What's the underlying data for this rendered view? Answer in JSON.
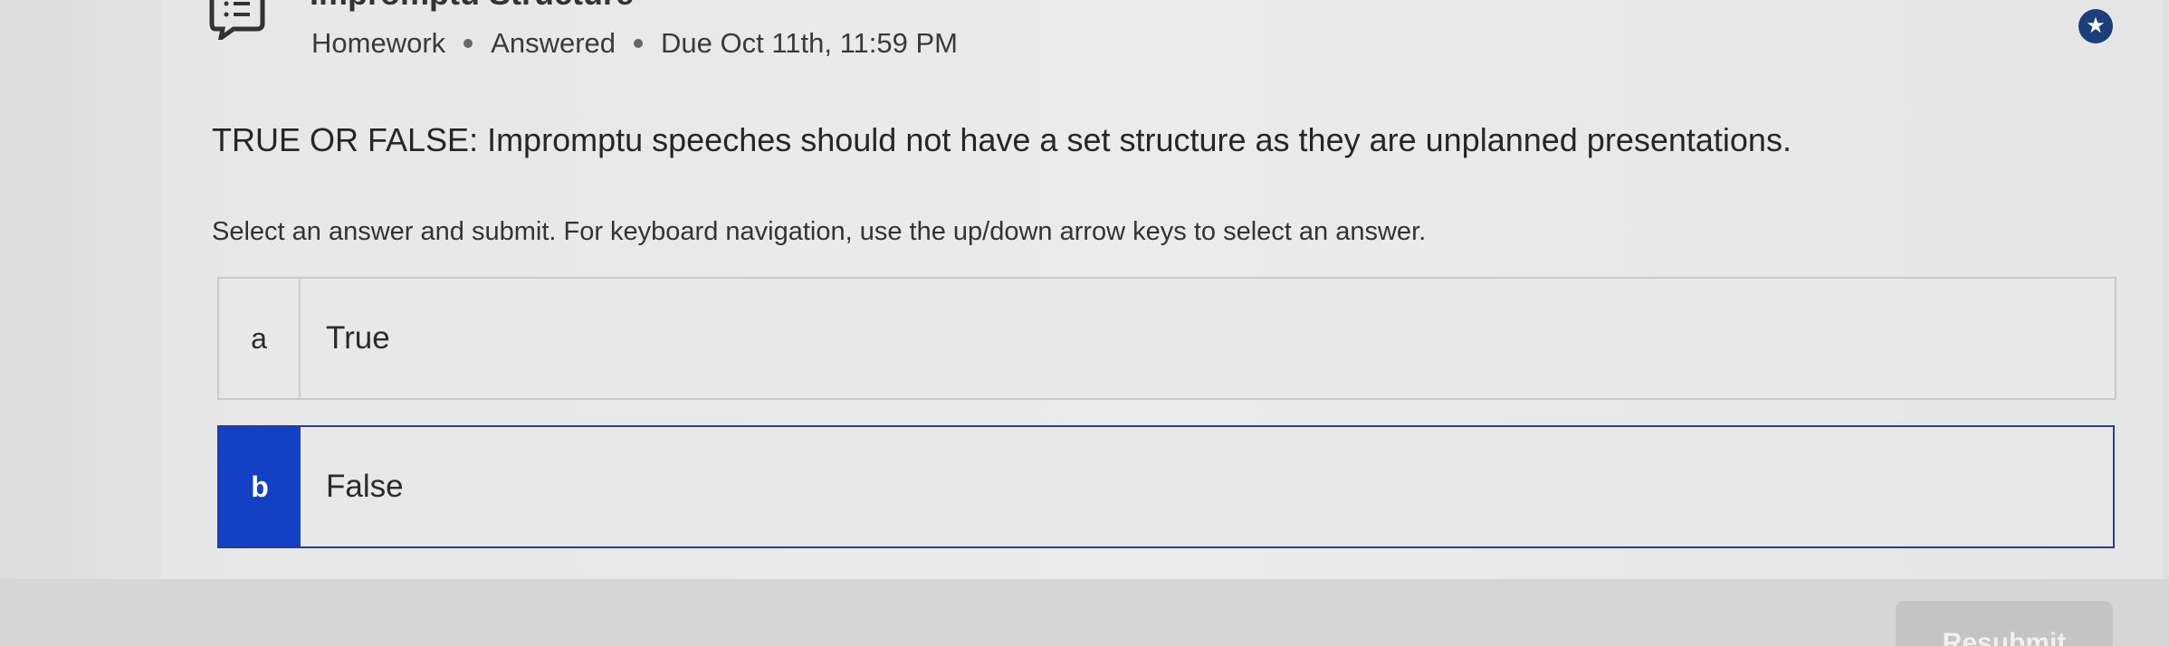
{
  "header": {
    "title": "Impromptu Structure",
    "type": "Homework",
    "status": "Answered",
    "due": "Due Oct 11th, 11:59 PM"
  },
  "question": {
    "text": "TRUE OR FALSE: Impromptu speeches should not have a set structure as they are unplanned presentations.",
    "instructions": "Select an answer and submit. For keyboard navigation, use the up/down arrow keys to select an answer."
  },
  "options": [
    {
      "letter": "a",
      "text": "True",
      "selected": false
    },
    {
      "letter": "b",
      "text": "False",
      "selected": true
    }
  ],
  "actions": {
    "resubmit_label": "Resubmit"
  },
  "icons": {
    "topic": "list-chat-icon",
    "favorite": "star-icon"
  },
  "colors": {
    "accent": "#1441c4",
    "selected_border": "#2a3e8c",
    "star_bg": "#1b3f7a"
  }
}
